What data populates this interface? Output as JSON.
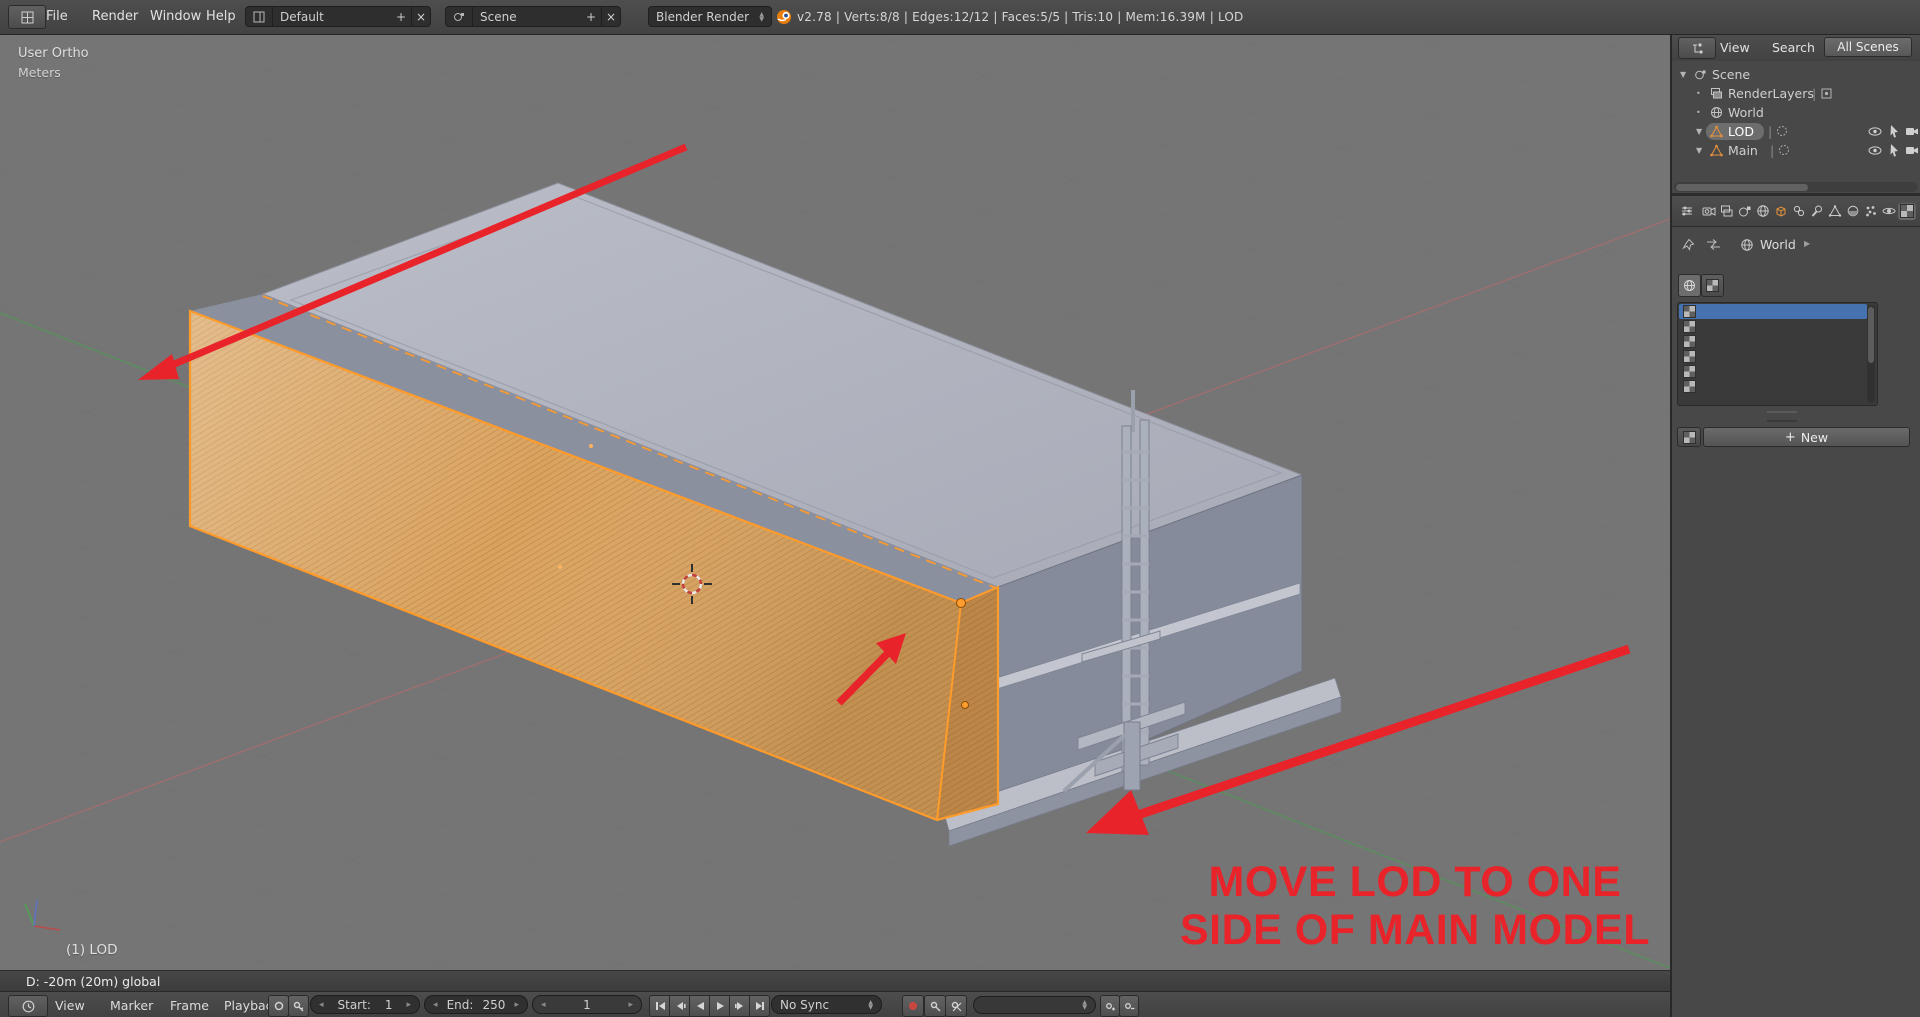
{
  "header": {
    "menus": {
      "file": "File",
      "render": "Render",
      "window": "Window",
      "help": "Help"
    },
    "layout_selector": {
      "value": "Default",
      "add": "+",
      "close": "×"
    },
    "scene_selector": {
      "value": "Scene",
      "add": "+",
      "close": "×"
    },
    "render_engine": "Blender Render",
    "stats": "v2.78 | Verts:8/8 | Edges:12/12 | Faces:5/5 | Tris:10 | Mem:16.39M | LOD"
  },
  "viewport": {
    "view_label": "User Ortho",
    "units_label": "Meters",
    "active_object_label": "(1) LOD",
    "transform_info": "D: -20m (20m) global",
    "annotation": {
      "line1": "MOVE LOD TO ONE",
      "line2": "SIDE OF MAIN MODEL"
    }
  },
  "timeline": {
    "menus": {
      "view": "View",
      "marker": "Marker",
      "frame": "Frame",
      "playback": "Playback"
    },
    "start_label": "Start:",
    "start_value": "1",
    "end_label": "End:",
    "end_value": "250",
    "current_frame": "1",
    "sync_mode": "No Sync"
  },
  "outliner": {
    "menus": {
      "view": "View",
      "search": "Search"
    },
    "display_filter": "All Scenes",
    "tree": [
      {
        "label": "Scene"
      },
      {
        "label": "RenderLayers"
      },
      {
        "label": "World"
      },
      {
        "label": "LOD"
      },
      {
        "label": "Main"
      }
    ]
  },
  "properties": {
    "breadcrumb_context": "World",
    "new_button_label": "New"
  },
  "colors": {
    "selection_blue": "#4673b0",
    "object_highlight_orange": "#ff9b2b",
    "annotation_red": "#e8232a",
    "viewport_gray": "#757575"
  }
}
